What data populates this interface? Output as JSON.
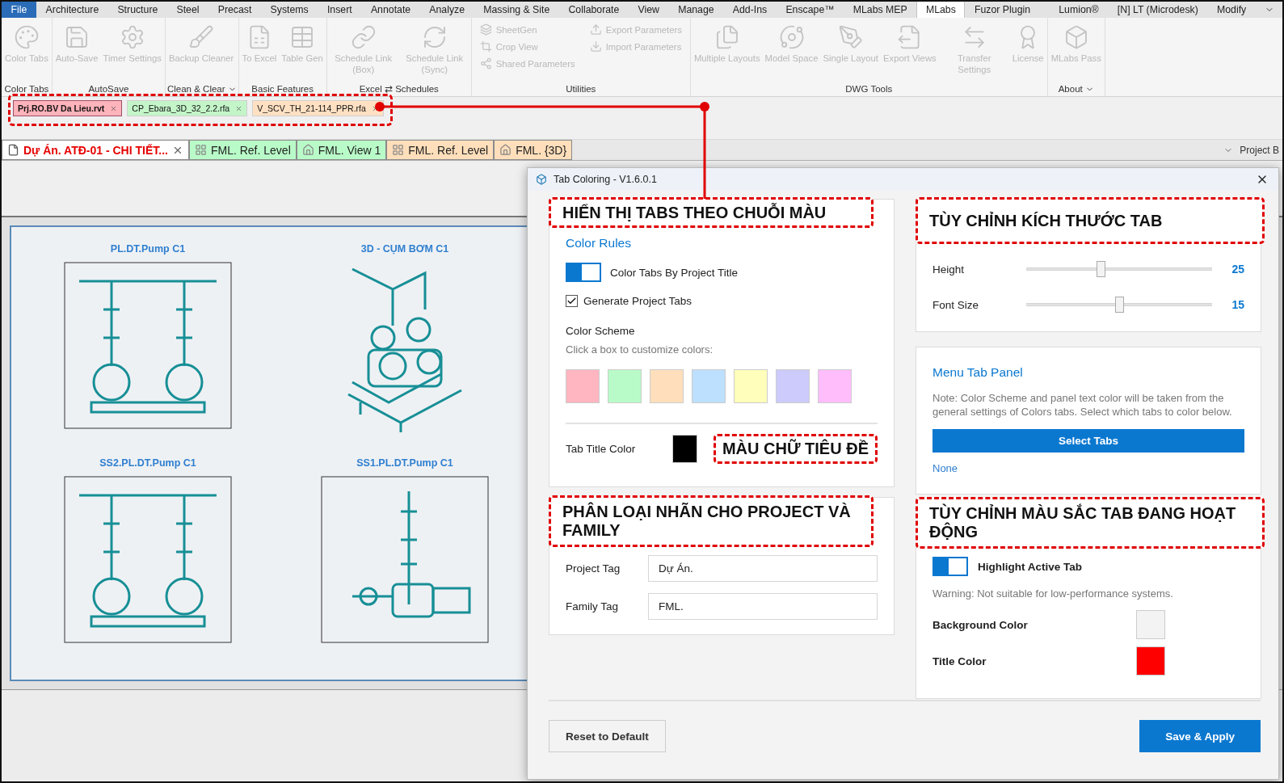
{
  "menu_tabs": [
    {
      "label": "File",
      "kind": "file"
    },
    {
      "label": "Architecture",
      "kind": "tab",
      "selected": false
    },
    {
      "label": "Structure",
      "kind": "tab",
      "selected": false
    },
    {
      "label": "Steel",
      "kind": "tab",
      "selected": false
    },
    {
      "label": "Precast",
      "kind": "tab",
      "selected": false
    },
    {
      "label": "Systems",
      "kind": "tab",
      "selected": false
    },
    {
      "label": "Insert",
      "kind": "tab",
      "selected": false
    },
    {
      "label": "Annotate",
      "kind": "tab",
      "selected": false
    },
    {
      "label": "Analyze",
      "kind": "tab",
      "selected": false
    },
    {
      "label": "Massing & Site",
      "kind": "tab",
      "selected": false
    },
    {
      "label": "Collaborate",
      "kind": "tab",
      "selected": false
    },
    {
      "label": "View",
      "kind": "tab",
      "selected": false
    },
    {
      "label": "Manage",
      "kind": "tab",
      "selected": false
    },
    {
      "label": "Add-Ins",
      "kind": "tab",
      "selected": false
    },
    {
      "label": "Enscape™",
      "kind": "tab",
      "selected": false
    },
    {
      "label": "MLabs MEP",
      "kind": "tab",
      "selected": false
    },
    {
      "label": "MLabs",
      "kind": "tab",
      "selected": true
    },
    {
      "label": "Fuzor Plugin",
      "kind": "tab",
      "selected": false
    },
    {
      "kind": "redacted"
    },
    {
      "label": "Lumion®",
      "kind": "tab",
      "selected": false
    },
    {
      "label": "[N] LT (Microdesk)",
      "kind": "tab",
      "selected": false
    },
    {
      "label": "Modify",
      "kind": "tab",
      "selected": false
    }
  ],
  "ribbon_groups": [
    {
      "label": "Color Tabs",
      "dropdown": false,
      "items": [
        {
          "kind": "large",
          "label": "Color Tabs",
          "disabled": true
        }
      ]
    },
    {
      "label": "AutoSave",
      "dropdown": false,
      "items": [
        {
          "kind": "large",
          "label": "Auto-Save",
          "disabled": true
        },
        {
          "kind": "large",
          "label": "Timer Settings",
          "disabled": true
        }
      ]
    },
    {
      "label": "Clean & Clear",
      "dropdown": true,
      "items": [
        {
          "kind": "large",
          "label": "Backup Cleaner",
          "disabled": true
        }
      ]
    },
    {
      "label": "Basic Features",
      "dropdown": false,
      "items": [
        {
          "kind": "large",
          "label": "To Excel",
          "disabled": true
        },
        {
          "kind": "large",
          "label": "Table Gen",
          "disabled": true
        }
      ]
    },
    {
      "label": "Excel ⇄ Schedules",
      "dropdown": false,
      "items": [
        {
          "kind": "large",
          "label": "Schedule Link (Box)",
          "disabled": true
        },
        {
          "kind": "large",
          "label": "Schedule Link (Sync)",
          "disabled": true
        }
      ]
    },
    {
      "label": "Utilities",
      "dropdown": false,
      "items": [
        {
          "kind": "stack",
          "tools": [
            {
              "label": "SheetGen",
              "disabled": true
            },
            {
              "label": "Crop View",
              "disabled": true
            },
            {
              "label": "Shared Parameters",
              "disabled": true
            }
          ]
        },
        {
          "kind": "stack",
          "tools": [
            {
              "label": "Export Parameters",
              "disabled": true
            },
            {
              "label": "Import Parameters",
              "disabled": true
            }
          ]
        }
      ]
    },
    {
      "label": "DWG Tools",
      "dropdown": false,
      "items": [
        {
          "kind": "large",
          "label": "Multiple Layouts",
          "disabled": true
        },
        {
          "kind": "large",
          "label": "Model Space",
          "disabled": true
        },
        {
          "kind": "large",
          "label": "Single Layout",
          "disabled": true
        },
        {
          "kind": "large",
          "label": "Export Views",
          "disabled": true
        },
        {
          "kind": "large",
          "label": "Transfer Settings",
          "disabled": true
        },
        {
          "kind": "large",
          "label": "License",
          "disabled": true
        }
      ]
    },
    {
      "label": "About",
      "dropdown": true,
      "items": [
        {
          "kind": "large",
          "label": "MLabs Pass",
          "disabled": true
        }
      ]
    }
  ],
  "project_tabs": [
    {
      "label": "Prj.RO.BV Da Lieu.rvt",
      "color": "#ffb3ba",
      "selected": true
    },
    {
      "label": "CP_Ebara_3D_32_2.2.rfa",
      "color": "#c3f5c8",
      "selected": false
    },
    {
      "label": "V_SCV_TH_21-114_PPR.rfa",
      "color": "#ffe0c2",
      "selected": false
    }
  ],
  "view_tabs": [
    {
      "label": "Dự Án. ATĐ-01 - CHI TIẾT...",
      "kind": "sheet",
      "color": "#ffffff",
      "selected": true
    },
    {
      "label": "FML. Ref. Level",
      "kind": "plan",
      "color": "#b9fbc8",
      "selected": false
    },
    {
      "label": "FML. View 1",
      "kind": "perspective",
      "color": "#b9fbc8",
      "selected": false
    },
    {
      "label": "FML. Ref. Level",
      "kind": "plan",
      "color": "#ffdfbb",
      "selected": false
    },
    {
      "label": "FML. {3D}",
      "kind": "perspective",
      "color": "#ffdfbb",
      "selected": false
    }
  ],
  "project_browser": {
    "label": "Project B"
  },
  "sheet": {
    "views": [
      {
        "title": "PL.DT.Pump C1",
        "kind": "elevation"
      },
      {
        "title": "3D - CỤM BƠM C1",
        "kind": "isometric"
      },
      {
        "title": "SS2.PL.DT.Pump C1",
        "kind": "elevation"
      },
      {
        "title": "SS1.PL.DT.Pump C1",
        "kind": "side"
      }
    ]
  },
  "dialog": {
    "title": "Tab Coloring - V1.6.0.1",
    "color_rules": {
      "callout": "HIỂN THỊ TABS THEO CHUỖI MÀU",
      "heading": "Color Rules",
      "toggle": {
        "label": "Color Tabs By Project Title",
        "on": true
      },
      "checkbox": {
        "label": "Generate Project Tabs",
        "checked": true
      },
      "scheme_title": "Color Scheme",
      "scheme_hint": "Click a box to customize colors:",
      "swatches": [
        {
          "color": "#ffb6c1"
        },
        {
          "color": "#b9fbc8"
        },
        {
          "color": "#ffdfbb"
        },
        {
          "color": "#bde0fe"
        },
        {
          "color": "#ffffbb"
        },
        {
          "color": "#cccbfb"
        },
        {
          "color": "#ffbdfb"
        }
      ],
      "title_color": {
        "label": "Tab Title Color",
        "color": "#000000",
        "callout": "MÀU CHỮ TIÊU ĐỀ"
      }
    },
    "tags": {
      "callout": "PHÂN LOẠI NHÃN CHO PROJECT VÀ FAMILY",
      "fields": [
        {
          "label": "Project Tag",
          "value": "Dự Án."
        },
        {
          "label": "Family Tag",
          "value": "FML."
        }
      ]
    },
    "size": {
      "callout": "TÙY CHỈNH KÍCH THƯỚC TAB",
      "sliders": [
        {
          "label": "Height",
          "level": 0.4,
          "reading": "25"
        },
        {
          "label": "Font Size",
          "level": 0.5,
          "reading": "15"
        }
      ]
    },
    "menu_panel": {
      "heading": "Menu Tab Panel",
      "note": "Note: Color Scheme and panel text color will be taken from the general settings of Colors tabs. Select which tabs to color below.",
      "button": "Select Tabs",
      "selection": "None"
    },
    "highlight": {
      "callout": "TÙY CHỈNH MÀU SẮC TAB ĐANG HOẠT ĐỘNG",
      "toggle": {
        "label": "Highlight Active Tab",
        "on": true
      },
      "warning": "Warning: Not suitable for low-performance systems.",
      "colors": [
        {
          "label": "Background Color",
          "color": "#f3f3f3"
        },
        {
          "label": "Title Color",
          "color": "#ff0000"
        }
      ]
    },
    "buttons": {
      "reset": "Reset to Default",
      "save": "Save & Apply"
    }
  }
}
